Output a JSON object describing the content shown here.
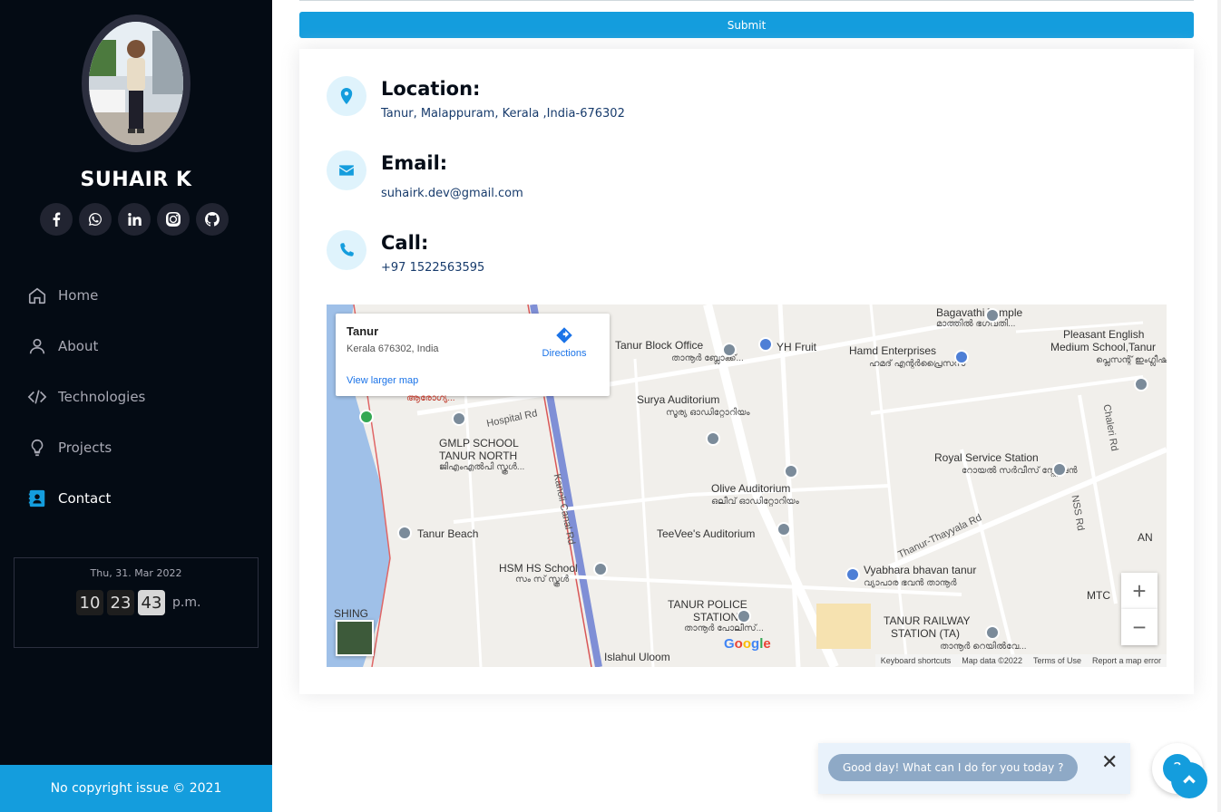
{
  "profile": {
    "name": "SUHAIR K"
  },
  "socials": [
    {
      "icon": "facebook-icon"
    },
    {
      "icon": "whatsapp-icon"
    },
    {
      "icon": "linkedin-icon"
    },
    {
      "icon": "instagram-icon"
    },
    {
      "icon": "github-icon"
    }
  ],
  "nav": [
    {
      "label": "Home",
      "icon": "home-icon"
    },
    {
      "label": "About",
      "icon": "user-icon"
    },
    {
      "label": "Technologies",
      "icon": "code-icon"
    },
    {
      "label": "Projects",
      "icon": "lightbulb-icon"
    },
    {
      "label": "Contact",
      "icon": "contact-card-icon",
      "active": true
    }
  ],
  "clock": {
    "date": "Thu, 31. Mar 2022",
    "hours": "10",
    "minutes": "23",
    "seconds": "43",
    "ampm": "p.m."
  },
  "footer": {
    "copyright": "No copyright issue © 2021"
  },
  "form": {
    "submit_label": "Submit"
  },
  "contact": {
    "location_title": "Location:",
    "location_text": "Tanur, Malappuram, Kerala ,India-676302",
    "email_title": "Email:",
    "email_text": "suhairk.dev@gmail.com",
    "call_title": "Call:",
    "call_text": "+97 1522563595"
  },
  "map": {
    "popup_title": "Tanur",
    "popup_address": "Kerala 676302, India",
    "popup_link": "View larger map",
    "directions_label": "Directions",
    "zoom_in": "+",
    "zoom_out": "−",
    "labels": {
      "bagavathi": "Bagavathi Temple",
      "bagavathi_ml": "മാത്തിൽ ഭഗവതി...",
      "tanur_block": "Tanur Block Office",
      "tanur_block_ml": "താനൂർ ബ്ലോക്ക്...",
      "yh_fruit": "YH Fruit",
      "hamd": "Hamd Enterprises",
      "hamd_ml": "ഹമദ് എന്റർപ്രൈസസ്",
      "pleasant1": "Pleasant English",
      "pleasant2": "Medium School,Tanur",
      "pleasant_ml": "പ്ലെസന്റ് ഇംഗ്ലീഷ്...",
      "surya": "Surya Auditorium",
      "surya_ml": "സൂര്യ ഓഡിറ്റോറിയം",
      "hospital_rd": "Hospital Rd",
      "arogya": "ആരോഗ്യ...",
      "gmlp1": "GMLP SCHOOL",
      "gmlp2": "TANUR NORTH",
      "gmlp_ml": "ജിഎംഎൽപി സ്കൂൾ...",
      "kanoli": "Kanoli Canal Rd",
      "olive": "Olive Auditorium",
      "olive_ml": "ഒലീവ് ഓഡിറ്റോറിയം",
      "royal": "Royal Service Station",
      "royal_ml": "റോയൽ സർവീസ് സ്റ്റേഷൻ",
      "chaleri": "Chaleri Rd",
      "nss": "NSS Rd",
      "tanur_thayyala": "Thanur-Thayyala Rd",
      "tanur_beach": "Tanur Beach",
      "teevees": "TeeVee's Auditorium",
      "hsm1": "HSM HS School",
      "hsm_ml": "സം സ് സ്കൂൾ",
      "vyabhara": "Vyabhara bhavan tanur",
      "vyabhara_ml": "വ്യാപാര ഭവൻ താനൂർ",
      "police1": "TANUR POLICE",
      "police2": "STATION",
      "police_ml": "താനൂർ പോലീസ്...",
      "railway1": "TANUR RAILWAY",
      "railway2": "STATION (TA)",
      "railway_ml": "താനൂർ റെയിൽവേ...",
      "mtc": "MTC",
      "an": "AN",
      "islahul": "Islahul Uloom",
      "shing": "SHING"
    },
    "footer": {
      "shortcuts": "Keyboard shortcuts",
      "data": "Map data ©2022",
      "terms": "Terms of Use",
      "report": "Report a map error"
    }
  },
  "chat": {
    "message": "Good day! What can I do for you today ?",
    "close": "✕",
    "fab": "?"
  },
  "colors": {
    "accent": "#149ddd",
    "sidebar_bg": "#040b14"
  }
}
